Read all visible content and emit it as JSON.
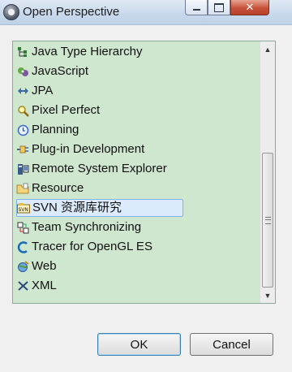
{
  "window": {
    "title": "Open Perspective",
    "close_glyph": "✕"
  },
  "perspectives": [
    {
      "label": "Java Type Hierarchy",
      "icon": "hierarchy-icon"
    },
    {
      "label": "JavaScript",
      "icon": "javascript-icon"
    },
    {
      "label": "JPA",
      "icon": "jpa-icon"
    },
    {
      "label": "Pixel Perfect",
      "icon": "magnifier-icon"
    },
    {
      "label": "Planning",
      "icon": "clock-icon"
    },
    {
      "label": "Plug-in Development",
      "icon": "plugin-icon"
    },
    {
      "label": "Remote System Explorer",
      "icon": "remote-system-icon"
    },
    {
      "label": "Resource",
      "icon": "folder-icon"
    },
    {
      "label": "SVN 资源库研究",
      "icon": "svn-icon",
      "selected": true
    },
    {
      "label": "Team Synchronizing",
      "icon": "team-sync-icon"
    },
    {
      "label": "Tracer for OpenGL ES",
      "icon": "opengl-tracer-icon"
    },
    {
      "label": "Web",
      "icon": "web-icon"
    },
    {
      "label": "XML",
      "icon": "xml-icon"
    }
  ],
  "buttons": {
    "ok": "OK",
    "cancel": "Cancel"
  },
  "colors": {
    "list_background": "#cfe6cf",
    "selection": "#dcebfb"
  }
}
